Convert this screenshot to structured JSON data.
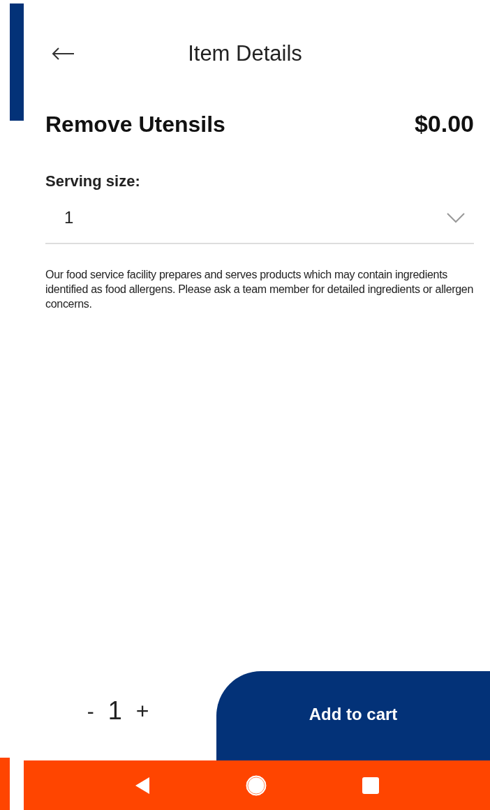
{
  "header": {
    "title": "Item Details"
  },
  "item": {
    "name": "Remove Utensils",
    "price": "$0.00"
  },
  "serving_size": {
    "label": "Serving size:",
    "value": "1"
  },
  "disclaimer": "Our food service facility prepares and serves products which may contain ingredients identified as food allergens. Please ask a team member for detailed ingredients or allergen concerns.",
  "quantity": {
    "decrease": "-",
    "value": "1",
    "increase": "+"
  },
  "add_button": "Add to cart"
}
